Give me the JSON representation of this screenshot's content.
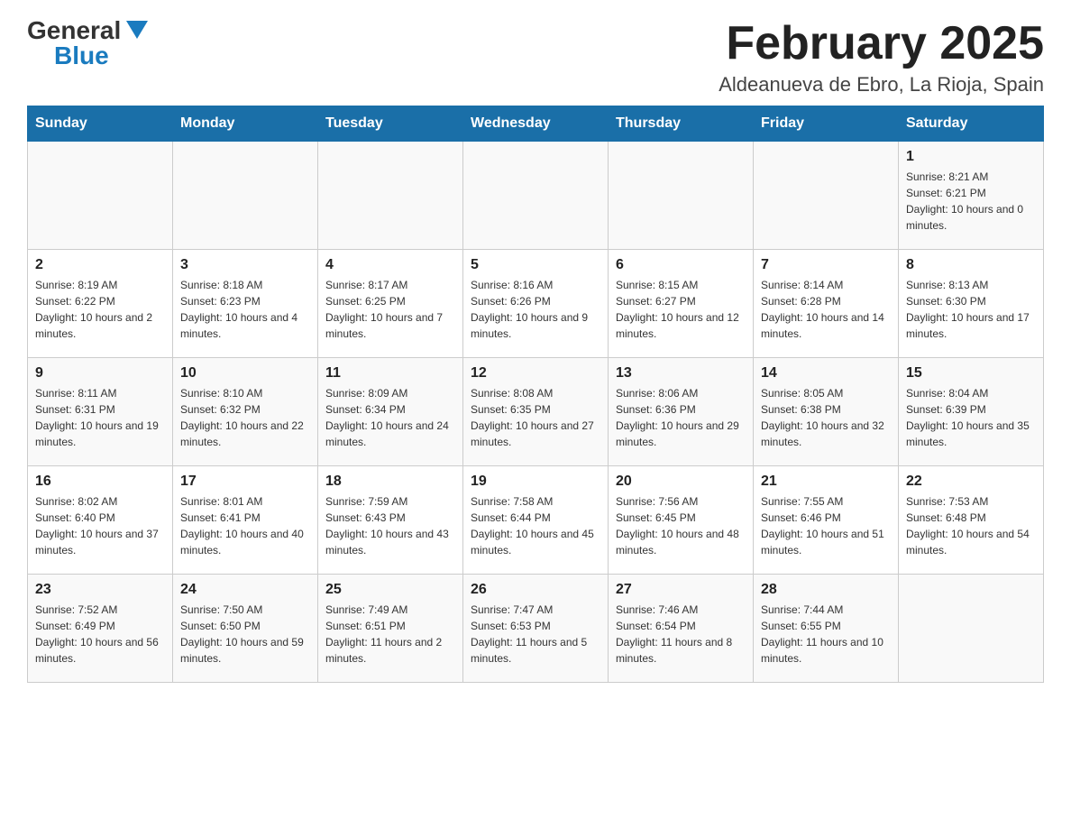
{
  "header": {
    "logo_general": "General",
    "logo_blue": "Blue",
    "month_title": "February 2025",
    "location": "Aldeanueva de Ebro, La Rioja, Spain"
  },
  "weekdays": [
    "Sunday",
    "Monday",
    "Tuesday",
    "Wednesday",
    "Thursday",
    "Friday",
    "Saturday"
  ],
  "weeks": [
    [
      {
        "day": "",
        "info": ""
      },
      {
        "day": "",
        "info": ""
      },
      {
        "day": "",
        "info": ""
      },
      {
        "day": "",
        "info": ""
      },
      {
        "day": "",
        "info": ""
      },
      {
        "day": "",
        "info": ""
      },
      {
        "day": "1",
        "info": "Sunrise: 8:21 AM\nSunset: 6:21 PM\nDaylight: 10 hours and 0 minutes."
      }
    ],
    [
      {
        "day": "2",
        "info": "Sunrise: 8:19 AM\nSunset: 6:22 PM\nDaylight: 10 hours and 2 minutes."
      },
      {
        "day": "3",
        "info": "Sunrise: 8:18 AM\nSunset: 6:23 PM\nDaylight: 10 hours and 4 minutes."
      },
      {
        "day": "4",
        "info": "Sunrise: 8:17 AM\nSunset: 6:25 PM\nDaylight: 10 hours and 7 minutes."
      },
      {
        "day": "5",
        "info": "Sunrise: 8:16 AM\nSunset: 6:26 PM\nDaylight: 10 hours and 9 minutes."
      },
      {
        "day": "6",
        "info": "Sunrise: 8:15 AM\nSunset: 6:27 PM\nDaylight: 10 hours and 12 minutes."
      },
      {
        "day": "7",
        "info": "Sunrise: 8:14 AM\nSunset: 6:28 PM\nDaylight: 10 hours and 14 minutes."
      },
      {
        "day": "8",
        "info": "Sunrise: 8:13 AM\nSunset: 6:30 PM\nDaylight: 10 hours and 17 minutes."
      }
    ],
    [
      {
        "day": "9",
        "info": "Sunrise: 8:11 AM\nSunset: 6:31 PM\nDaylight: 10 hours and 19 minutes."
      },
      {
        "day": "10",
        "info": "Sunrise: 8:10 AM\nSunset: 6:32 PM\nDaylight: 10 hours and 22 minutes."
      },
      {
        "day": "11",
        "info": "Sunrise: 8:09 AM\nSunset: 6:34 PM\nDaylight: 10 hours and 24 minutes."
      },
      {
        "day": "12",
        "info": "Sunrise: 8:08 AM\nSunset: 6:35 PM\nDaylight: 10 hours and 27 minutes."
      },
      {
        "day": "13",
        "info": "Sunrise: 8:06 AM\nSunset: 6:36 PM\nDaylight: 10 hours and 29 minutes."
      },
      {
        "day": "14",
        "info": "Sunrise: 8:05 AM\nSunset: 6:38 PM\nDaylight: 10 hours and 32 minutes."
      },
      {
        "day": "15",
        "info": "Sunrise: 8:04 AM\nSunset: 6:39 PM\nDaylight: 10 hours and 35 minutes."
      }
    ],
    [
      {
        "day": "16",
        "info": "Sunrise: 8:02 AM\nSunset: 6:40 PM\nDaylight: 10 hours and 37 minutes."
      },
      {
        "day": "17",
        "info": "Sunrise: 8:01 AM\nSunset: 6:41 PM\nDaylight: 10 hours and 40 minutes."
      },
      {
        "day": "18",
        "info": "Sunrise: 7:59 AM\nSunset: 6:43 PM\nDaylight: 10 hours and 43 minutes."
      },
      {
        "day": "19",
        "info": "Sunrise: 7:58 AM\nSunset: 6:44 PM\nDaylight: 10 hours and 45 minutes."
      },
      {
        "day": "20",
        "info": "Sunrise: 7:56 AM\nSunset: 6:45 PM\nDaylight: 10 hours and 48 minutes."
      },
      {
        "day": "21",
        "info": "Sunrise: 7:55 AM\nSunset: 6:46 PM\nDaylight: 10 hours and 51 minutes."
      },
      {
        "day": "22",
        "info": "Sunrise: 7:53 AM\nSunset: 6:48 PM\nDaylight: 10 hours and 54 minutes."
      }
    ],
    [
      {
        "day": "23",
        "info": "Sunrise: 7:52 AM\nSunset: 6:49 PM\nDaylight: 10 hours and 56 minutes."
      },
      {
        "day": "24",
        "info": "Sunrise: 7:50 AM\nSunset: 6:50 PM\nDaylight: 10 hours and 59 minutes."
      },
      {
        "day": "25",
        "info": "Sunrise: 7:49 AM\nSunset: 6:51 PM\nDaylight: 11 hours and 2 minutes."
      },
      {
        "day": "26",
        "info": "Sunrise: 7:47 AM\nSunset: 6:53 PM\nDaylight: 11 hours and 5 minutes."
      },
      {
        "day": "27",
        "info": "Sunrise: 7:46 AM\nSunset: 6:54 PM\nDaylight: 11 hours and 8 minutes."
      },
      {
        "day": "28",
        "info": "Sunrise: 7:44 AM\nSunset: 6:55 PM\nDaylight: 11 hours and 10 minutes."
      },
      {
        "day": "",
        "info": ""
      }
    ]
  ]
}
